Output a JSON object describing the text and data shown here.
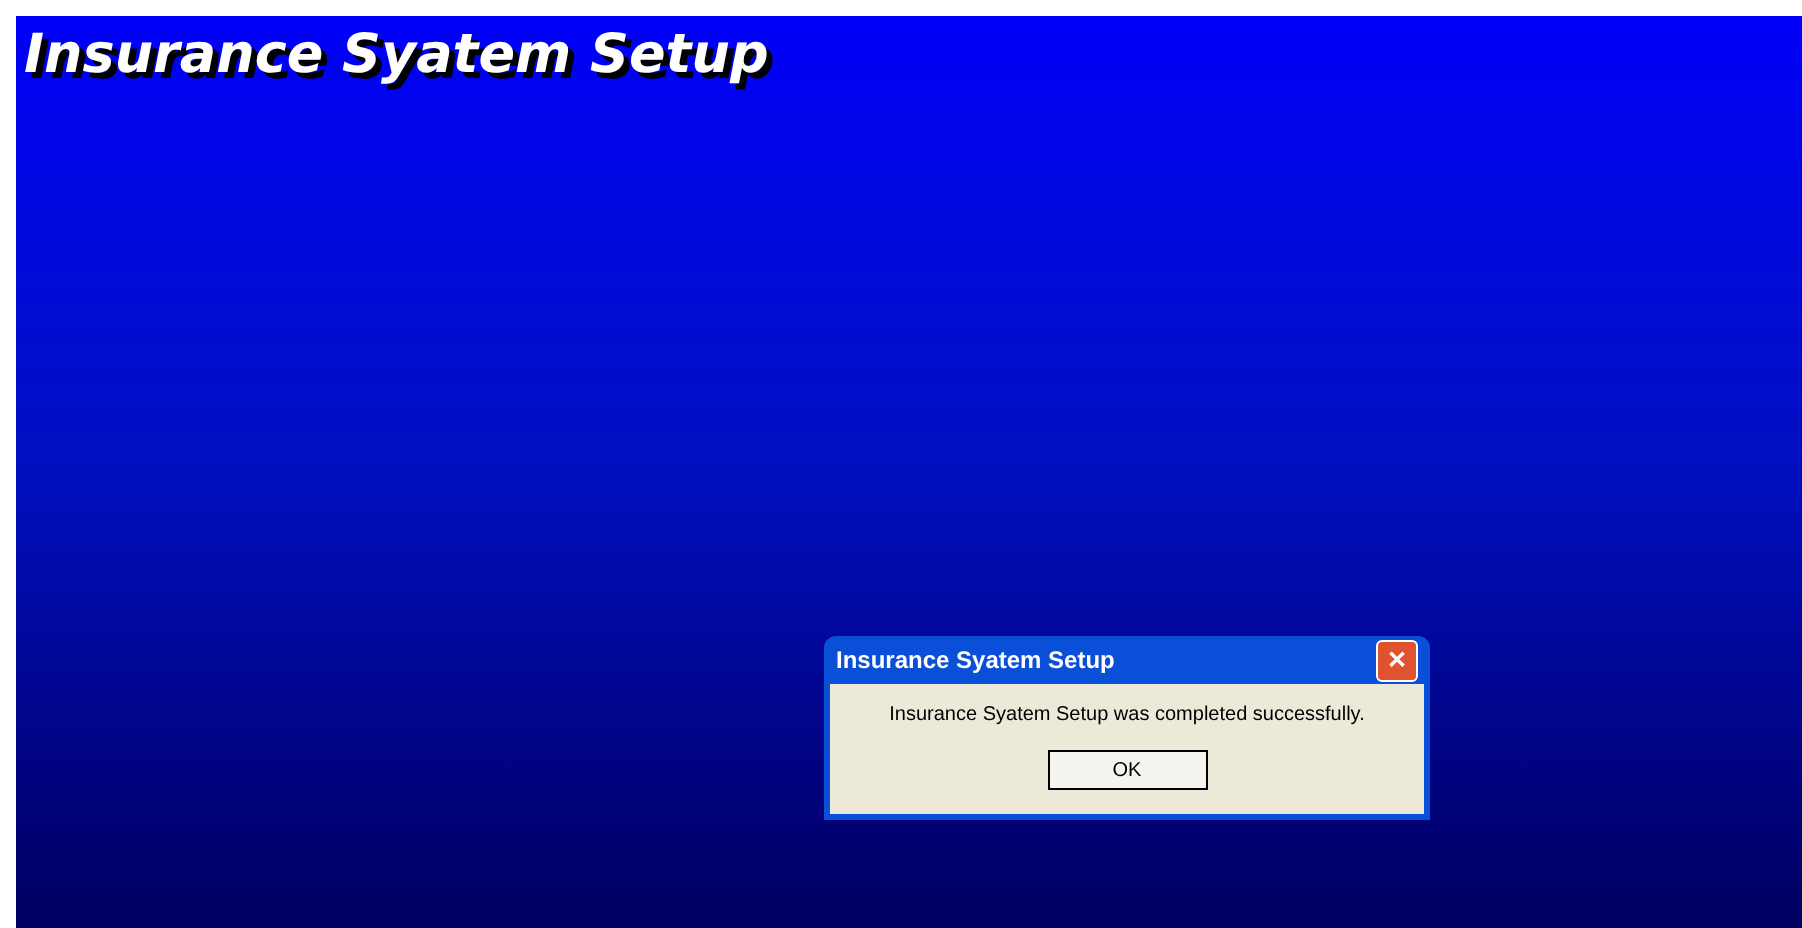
{
  "screen": {
    "title": "Insurance Syatem Setup"
  },
  "dialog": {
    "title": "Insurance Syatem Setup",
    "close": "✕",
    "message": "Insurance Syatem Setup was completed successfully.",
    "buttons": [
      "OK"
    ]
  }
}
